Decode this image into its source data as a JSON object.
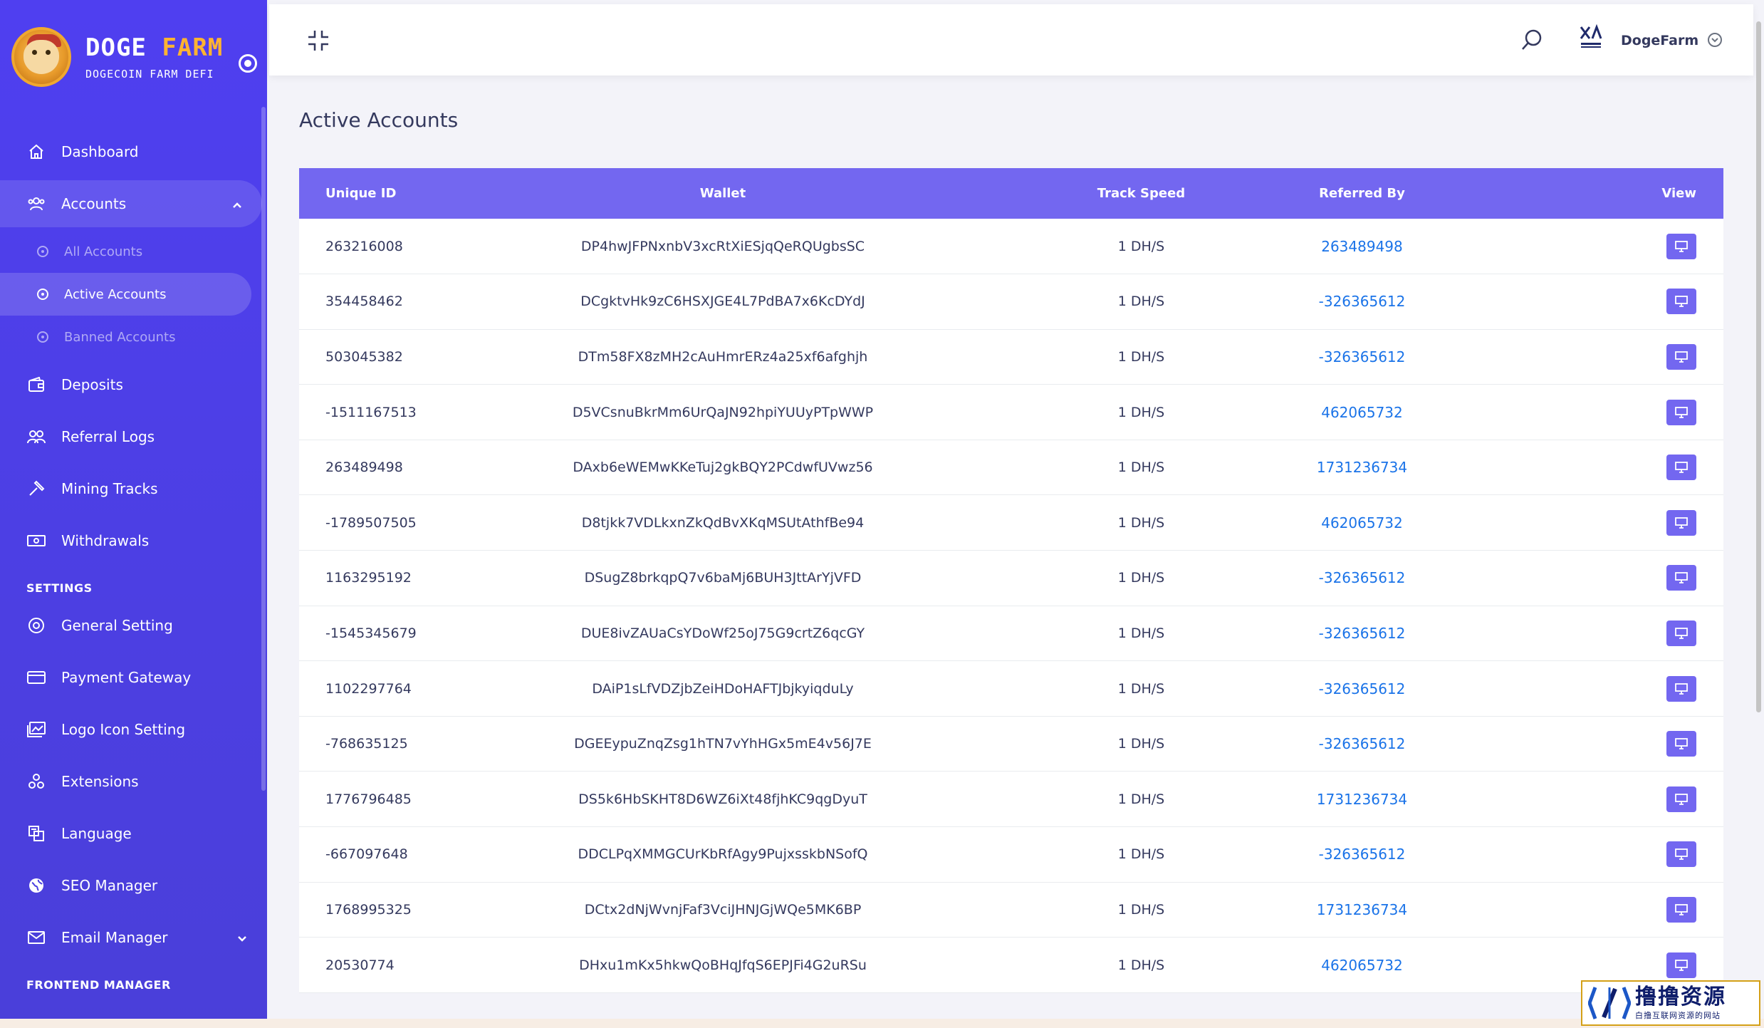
{
  "brand": {
    "title_part1": "DOGE",
    "title_part2": "FARM",
    "subtitle": "DOGECOIN FARM DEFI"
  },
  "sidebar": {
    "items": [
      {
        "label": "Dashboard",
        "icon": "home-icon"
      },
      {
        "label": "Accounts",
        "icon": "users-icon",
        "expanded": true,
        "children": [
          {
            "label": "All Accounts"
          },
          {
            "label": "Active Accounts",
            "active": true
          },
          {
            "label": "Banned Accounts"
          }
        ]
      },
      {
        "label": "Deposits",
        "icon": "wallet-icon"
      },
      {
        "label": "Referral Logs",
        "icon": "referral-icon"
      },
      {
        "label": "Mining Tracks",
        "icon": "hammer-icon"
      },
      {
        "label": "Withdrawals",
        "icon": "money-icon"
      }
    ],
    "settings_heading": "SETTINGS",
    "settings_items": [
      {
        "label": "General Setting",
        "icon": "life-ring-icon"
      },
      {
        "label": "Payment Gateway",
        "icon": "credit-card-icon"
      },
      {
        "label": "Logo Icon Setting",
        "icon": "images-icon"
      },
      {
        "label": "Extensions",
        "icon": "cogs-icon"
      },
      {
        "label": "Language",
        "icon": "language-icon"
      },
      {
        "label": "SEO Manager",
        "icon": "globe-icon"
      },
      {
        "label": "Email Manager",
        "icon": "envelope-icon"
      }
    ],
    "frontend_heading": "FRONTEND MANAGER"
  },
  "topbar": {
    "user_name": "DogeFarm"
  },
  "main": {
    "title": "Active Accounts",
    "columns": [
      "Unique ID",
      "Wallet",
      "Track Speed",
      "Referred By",
      "View"
    ],
    "rows": [
      {
        "id": "263216008",
        "wallet": "DP4hwJFPNxnbV3xcRtXiESjqQeRQUgbsSC",
        "speed": "1 DH/S",
        "ref": "263489498"
      },
      {
        "id": "354458462",
        "wallet": "DCgktvHk9zC6HSXJGE4L7PdBA7x6KcDYdJ",
        "speed": "1 DH/S",
        "ref": "-326365612"
      },
      {
        "id": "503045382",
        "wallet": "DTm58FX8zMH2cAuHmrERz4a25xf6afghjh",
        "speed": "1 DH/S",
        "ref": "-326365612"
      },
      {
        "id": "-1511167513",
        "wallet": "D5VCsnuBkrMm6UrQaJN92hpiYUUyPTpWWP",
        "speed": "1 DH/S",
        "ref": "462065732"
      },
      {
        "id": "263489498",
        "wallet": "DAxb6eWEMwKKeTuj2gkBQY2PCdwfUVwz56",
        "speed": "1 DH/S",
        "ref": "1731236734"
      },
      {
        "id": "-1789507505",
        "wallet": "D8tjkk7VDLkxnZkQdBvXKqMSUtAthfBe94",
        "speed": "1 DH/S",
        "ref": "462065732"
      },
      {
        "id": "1163295192",
        "wallet": "DSugZ8brkqpQ7v6baMj6BUH3JttArYjVFD",
        "speed": "1 DH/S",
        "ref": "-326365612"
      },
      {
        "id": "-1545345679",
        "wallet": "DUE8ivZAUaCsYDoWf25oJ75G9crtZ6qcGY",
        "speed": "1 DH/S",
        "ref": "-326365612"
      },
      {
        "id": "1102297764",
        "wallet": "DAiP1sLfVDZjbZeiHDoHAFTJbjkyiqduLy",
        "speed": "1 DH/S",
        "ref": "-326365612"
      },
      {
        "id": "-768635125",
        "wallet": "DGEEypuZnqZsg1hTN7vYhHGx5mE4v56J7E",
        "speed": "1 DH/S",
        "ref": "-326365612"
      },
      {
        "id": "1776796485",
        "wallet": "DS5k6HbSKHT8D6WZ6iXt48fjhKC9qgDyuT",
        "speed": "1 DH/S",
        "ref": "1731236734"
      },
      {
        "id": "-667097648",
        "wallet": "DDCLPqXMMGCUrKbRfAgy9PujxsskbNSofQ",
        "speed": "1 DH/S",
        "ref": "-326365612"
      },
      {
        "id": "1768995325",
        "wallet": "DCtx2dNjWvnjFaf3VciJHNJGjWQe5MK6BP",
        "speed": "1 DH/S",
        "ref": "1731236734"
      },
      {
        "id": "20530774",
        "wallet": "DHxu1mKx5hkwQoBHqJfqS6EPJFi4G2uRSu",
        "speed": "1 DH/S",
        "ref": "462065732"
      }
    ]
  },
  "watermark": {
    "main": "撸撸资源",
    "sub": "白撸互联网资源的网站"
  },
  "colors": {
    "sidebar": "#4a3fe0",
    "header": "#7367f0",
    "link": "#1a73e8",
    "brand_accent": "#ffb331"
  }
}
